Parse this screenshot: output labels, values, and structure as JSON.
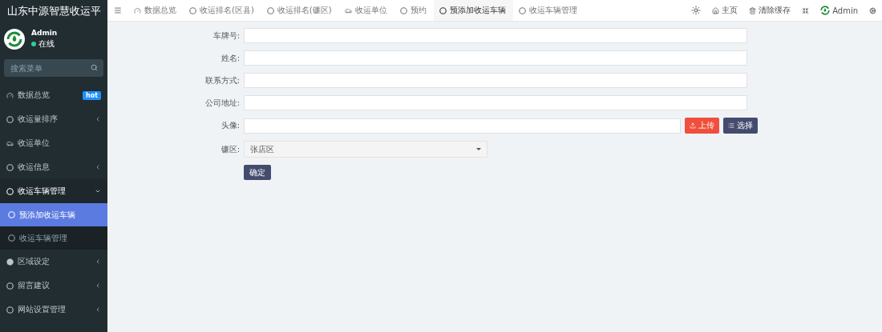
{
  "brand": {
    "title": "山东中源智慧收运平"
  },
  "user": {
    "name": "Admin",
    "status": "在线"
  },
  "search": {
    "placeholder": "搜索菜单"
  },
  "menu": [
    {
      "label": "数据总览",
      "kind": "gauge",
      "badge": "hot"
    },
    {
      "label": "收运量排序",
      "kind": "circle",
      "expanded": false
    },
    {
      "label": "收运单位",
      "kind": "car"
    },
    {
      "label": "收运信息",
      "kind": "circle",
      "expanded": false
    },
    {
      "label": "收运车辆管理",
      "kind": "circle",
      "expanded": true,
      "children": [
        {
          "label": "预添加收运车辆",
          "selected": true
        },
        {
          "label": "收运车辆管理",
          "selected": false
        }
      ]
    },
    {
      "label": "区域设定",
      "kind": "dot",
      "expanded": false
    },
    {
      "label": "留言建议",
      "kind": "circle",
      "expanded": false
    },
    {
      "label": "网站设置管理",
      "kind": "circle",
      "expanded": false
    }
  ],
  "tabs": [
    {
      "label": "数据总览",
      "kind": "gauge",
      "selected": false
    },
    {
      "label": "收运排名(区县)",
      "kind": "circle",
      "selected": false
    },
    {
      "label": "收运排名(镰区)",
      "kind": "circle",
      "selected": false
    },
    {
      "label": "收运单位",
      "kind": "car",
      "selected": false
    },
    {
      "label": "预约",
      "kind": "circle",
      "selected": false
    },
    {
      "label": "预添加收运车辆",
      "kind": "circle",
      "selected": true
    },
    {
      "label": "收运车辆管理",
      "kind": "circle",
      "selected": false
    }
  ],
  "toolbar": [
    {
      "kind": "sun"
    },
    {
      "kind": "home",
      "label": "主页"
    },
    {
      "kind": "trash",
      "label": "清除缓存"
    },
    {
      "kind": "expand"
    },
    {
      "kind": "logo",
      "label": "Admin"
    },
    {
      "kind": "cogs"
    }
  ],
  "form": {
    "fields": [
      {
        "label": "车牌号:",
        "kind": "text"
      },
      {
        "label": "姓名:",
        "kind": "text"
      },
      {
        "label": "联系方式:",
        "kind": "text"
      },
      {
        "label": "公司地址:",
        "kind": "text"
      },
      {
        "label": "头像:",
        "kind": "upload",
        "upload_label": "上传",
        "choose_label": "选择"
      },
      {
        "label": "镰区:",
        "kind": "select",
        "value": "张店区"
      }
    ],
    "submit": "确定"
  }
}
